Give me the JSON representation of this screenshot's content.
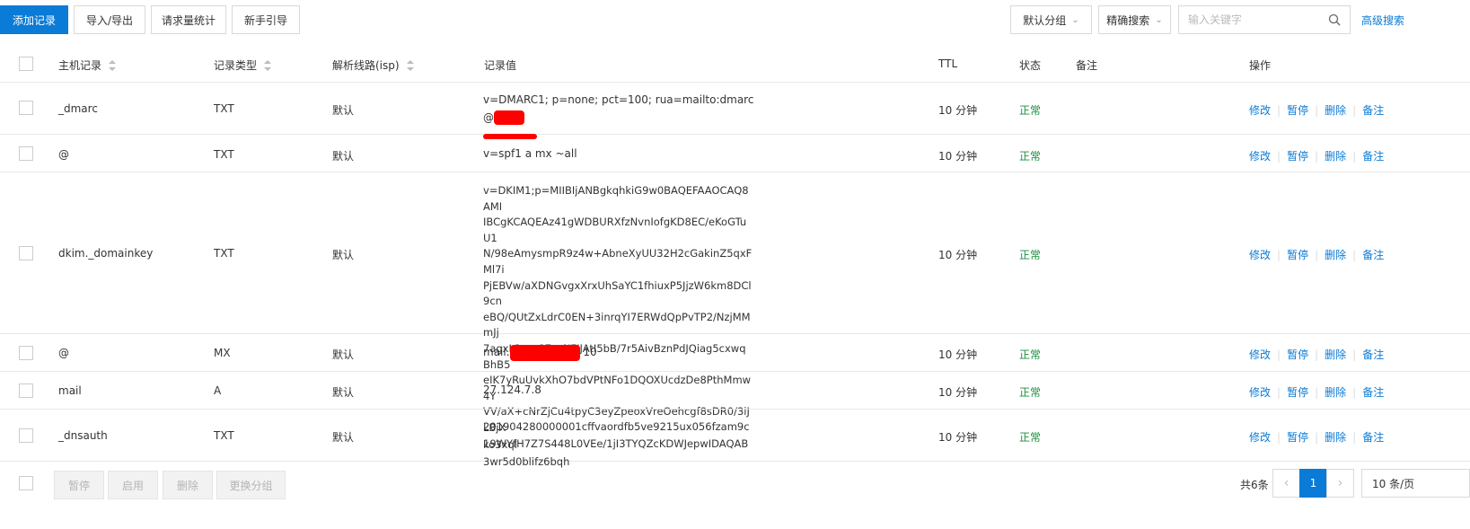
{
  "toolbar": {
    "add_record": "添加记录",
    "import_export": "导入/导出",
    "request_stats": "请求量统计",
    "beginner_guide": "新手引导",
    "group_select": "默认分组",
    "search_mode": "精确搜索",
    "search_placeholder": "输入关键字",
    "advanced_search": "高级搜索"
  },
  "table": {
    "headers": {
      "host": "主机记录",
      "type": "记录类型",
      "line": "解析线路(isp)",
      "value": "记录值",
      "ttl": "TTL",
      "status": "状态",
      "remark": "备注",
      "actions": "操作"
    },
    "action_labels": {
      "edit": "修改",
      "pause": "暂停",
      "delete": "删除",
      "remark": "备注"
    },
    "rows": [
      {
        "host": "_dmarc",
        "type": "TXT",
        "line": "默认",
        "value_lines": [
          "v=DMARC1; p=none; pct=100; rua=mailto:dmarc@"
        ],
        "ttl": "10 分钟",
        "status": "正常"
      },
      {
        "host": "@",
        "type": "TXT",
        "line": "默认",
        "value_lines": [
          "v=spf1 a mx ~all"
        ],
        "ttl": "10 分钟",
        "status": "正常"
      },
      {
        "host": "dkim._domainkey",
        "type": "TXT",
        "line": "默认",
        "value_lines": [
          "v=DKIM1;p=MIIBIjANBgkqhkiG9w0BAQEFAAOCAQ8AMI",
          "IBCgKCAQEAz41gWDBURXfzNvnIofgKD8EC/eKoGTuU1",
          "N/98eAmysmpR9z4w+AbneXyUU32H2cGakinZ5qxFMl7i",
          "PjEBVw/aXDNGvgxXrxUhSaYC1fhiuxP5JjzW6km8DCl9cn",
          "eBQ/QUtZxLdrC0EN+3inrqYI7ERWdQpPvTP2/NzjMMmJj",
          "7agxL2ssp87yzNFIJAtI5bB/7r5AivBznPdJQiag5cxwqBhB5",
          "eIK7yRuUvkXhO7bdVPtNFo1DQOXUcdzDe8PthMmw4Y",
          "VV/aX+cNrZjCu4tpyC3eyZpeoxVreOehcgf8sDR0/3iJLBjX",
          "19WYfH7Z7S448L0VEe/1jI3TYQZcKDWJepwIDAQAB"
        ],
        "ttl": "10 分钟",
        "status": "正常"
      },
      {
        "host": "@",
        "type": "MX",
        "line": "默认",
        "value_prefix": "mail.",
        "value_suffix": "10",
        "ttl": "10 分钟",
        "status": "正常"
      },
      {
        "host": "mail",
        "type": "A",
        "line": "默认",
        "value_lines": [
          "27.124.7.8"
        ],
        "ttl": "10 分钟",
        "status": "正常"
      },
      {
        "host": "_dnsauth",
        "type": "TXT",
        "line": "默认",
        "value_lines": [
          "201904280000001cffvaordfb5ve9215ux056fzam9cko3xql",
          "3wr5d0blifz6bqh"
        ],
        "ttl": "10 分钟",
        "status": "正常"
      }
    ]
  },
  "footer": {
    "pause": "暂停",
    "enable": "启用",
    "delete": "删除",
    "change_group": "更换分组",
    "total": "共6条",
    "current_page": "1",
    "page_size": "10 条/页"
  },
  "colors": {
    "primary": "#0a7bd6",
    "status_ok": "#1a8f3c",
    "redaction": "#ff0000"
  }
}
